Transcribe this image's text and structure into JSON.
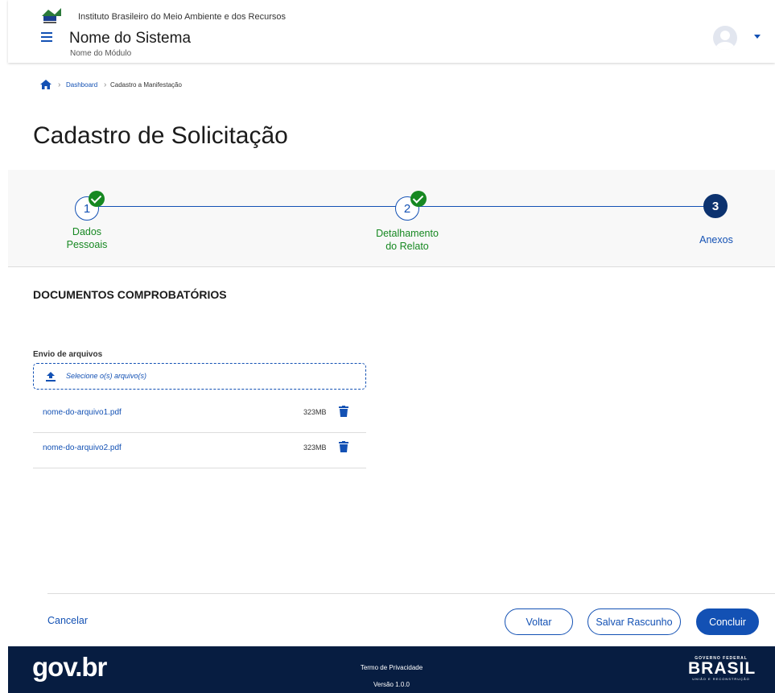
{
  "header": {
    "org_name": "Instituto Brasileiro do Meio Ambiente e dos Recursos",
    "system_name": "Nome do Sistema",
    "module_name": "Nome do Módulo"
  },
  "breadcrumb": {
    "items": [
      "Dashboard",
      "Cadastro a Manifestação"
    ]
  },
  "page": {
    "title": "Cadastro de Solicitação"
  },
  "stepper": {
    "steps": [
      {
        "number": "1",
        "label_line1": "Dados",
        "label_line2": "Pessoais",
        "status": "done"
      },
      {
        "number": "2",
        "label_line1": "Detalhamento",
        "label_line2": "do Relato",
        "status": "done"
      },
      {
        "number": "3",
        "label_line1": "Anexos",
        "label_line2": "",
        "status": "active"
      }
    ]
  },
  "section": {
    "title": "DOCUMENTOS COMPROBATÓRIOS",
    "upload_label": "Envio de arquivos",
    "upload_placeholder": "Selecione o(s) arquivo(s)",
    "files": [
      {
        "name": "nome-do-arquivo1.pdf",
        "size": "323MB"
      },
      {
        "name": "nome-do-arquivo2.pdf",
        "size": "323MB"
      }
    ]
  },
  "actions": {
    "cancel": "Cancelar",
    "back": "Voltar",
    "save_draft": "Salvar Rascunho",
    "finish": "Concluir"
  },
  "footer": {
    "brand": "gov.br",
    "privacy": "Termo de Privacidade",
    "version": "Versão 1.0.0",
    "gov_top": "GOVERNO FEDERAL",
    "gov_main": "BRASIL",
    "gov_bottom": "UNIÃO E RECONSTRUÇÃO"
  },
  "colors": {
    "primary": "#1351b4",
    "success": "#168821",
    "active_step": "#0c326f",
    "footer_bg": "#071d41"
  }
}
